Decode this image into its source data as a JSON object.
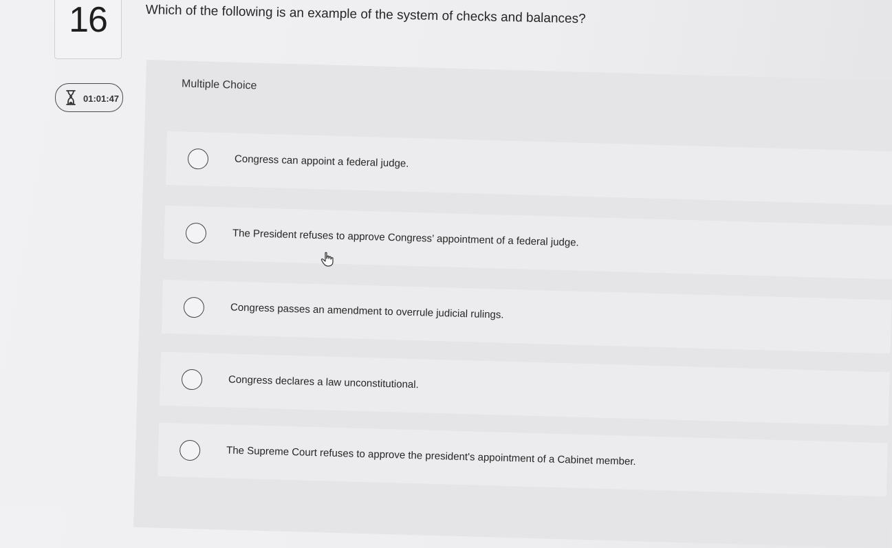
{
  "question": {
    "number": "16",
    "text": "Which of the following is an example of the system of checks and balances?"
  },
  "timer": {
    "icon": "hourglass-icon",
    "value": "01:01:47"
  },
  "panel": {
    "header": "Multiple Choice",
    "choices": [
      {
        "label": "Congress can appoint a federal judge."
      },
      {
        "label": "The President refuses to approve Congress’ appointment of a federal judge."
      },
      {
        "label": "Congress passes an amendment to overrule judicial rulings."
      },
      {
        "label": "Congress declares a law unconstitutional."
      },
      {
        "label": "The Supreme Court refuses to approve the president's appointment of a Cabinet member."
      }
    ]
  },
  "colors": {
    "background": "#eeeef0",
    "panel": "#e5e5e8",
    "choice": "#ececee",
    "text": "#262626"
  }
}
